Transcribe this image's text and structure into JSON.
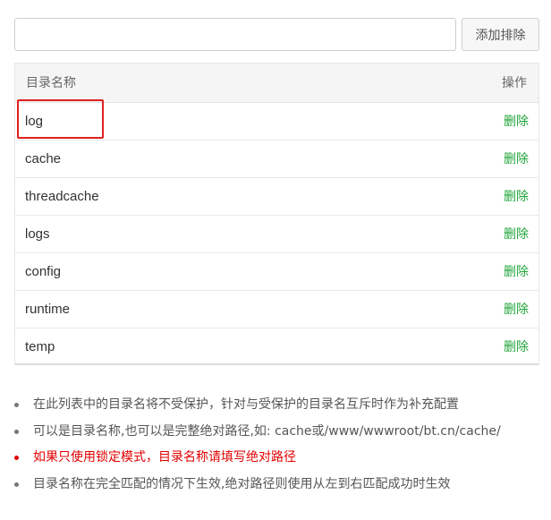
{
  "toolbar": {
    "input_value": "",
    "add_button_label": "添加排除"
  },
  "table": {
    "columns": [
      "目录名称",
      "操作"
    ],
    "rows": [
      {
        "name": "log",
        "action": "删除"
      },
      {
        "name": "cache",
        "action": "删除"
      },
      {
        "name": "threadcache",
        "action": "删除"
      },
      {
        "name": "logs",
        "action": "删除"
      },
      {
        "name": "config",
        "action": "删除"
      },
      {
        "name": "runtime",
        "action": "删除"
      },
      {
        "name": "temp",
        "action": "删除"
      }
    ]
  },
  "notes": [
    {
      "text": "在此列表中的目录名将不受保护，针对与受保护的目录名互斥时作为补充配置",
      "warn": false
    },
    {
      "text": "可以是目录名称,也可以是完整绝对路径,如: cache或/www/wwwroot/bt.cn/cache/",
      "warn": false
    },
    {
      "text": "如果只使用锁定模式，目录名称请填写绝对路径",
      "warn": true
    },
    {
      "text": "目录名称在完全匹配的情况下生效,绝对路径则使用从左到右匹配成功时生效",
      "warn": false
    }
  ],
  "colors": {
    "accent_green": "#20a53a",
    "warning_red": "#e00000",
    "highlight_red": "#e02020"
  }
}
